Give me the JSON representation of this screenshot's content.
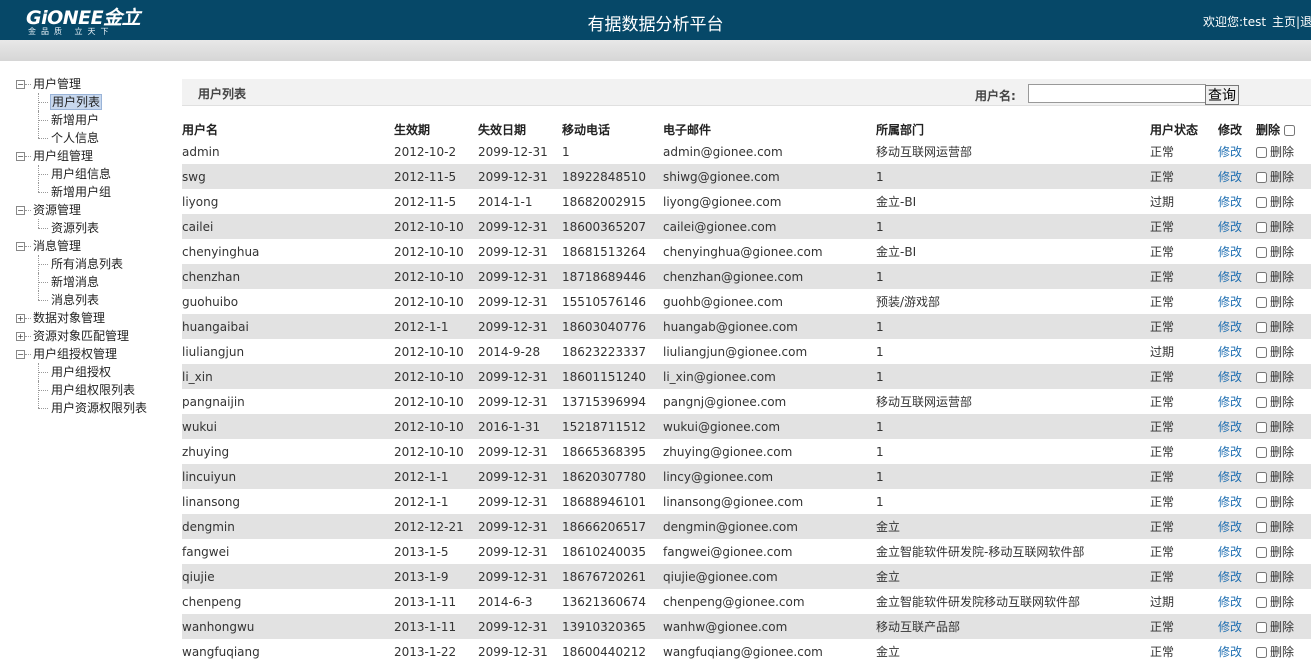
{
  "header": {
    "logo_main": "GiONEE金立",
    "logo_sub": "金品质 立天下",
    "title": "有据数据分析平台",
    "welcome": "欢迎您:test",
    "links": [
      "主页",
      "退"
    ]
  },
  "sidebar": {
    "groups": [
      {
        "label": "用户管理",
        "expanded": true,
        "children": [
          "用户列表",
          "新增用户",
          "个人信息"
        ]
      },
      {
        "label": "用户组管理",
        "expanded": true,
        "children": [
          "用户组信息",
          "新增用户组"
        ]
      },
      {
        "label": "资源管理",
        "expanded": true,
        "children": [
          "资源列表"
        ]
      },
      {
        "label": "消息管理",
        "expanded": true,
        "children": [
          "所有消息列表",
          "新增消息",
          "消息列表"
        ]
      },
      {
        "label": "数据对象管理",
        "expanded": false,
        "children": []
      },
      {
        "label": "资源对象匹配管理",
        "expanded": false,
        "children": []
      },
      {
        "label": "用户组授权管理",
        "expanded": true,
        "children": [
          "用户组授权",
          "用户组权限列表",
          "用户资源权限列表"
        ]
      }
    ],
    "selected": "用户列表"
  },
  "toolbar": {
    "list_title": "用户列表",
    "search_label": "用户名:",
    "search_value": "",
    "search_button": "查询"
  },
  "table": {
    "columns": [
      "用户名",
      "生效期",
      "失效日期",
      "移动电话",
      "电子邮件",
      "所属部门",
      "用户状态",
      "修改",
      "删除"
    ],
    "edit_label": "修改",
    "delete_label": "删除",
    "rows": [
      [
        "admin",
        "2012-10-2",
        "2099-12-31",
        "1",
        "admin@gionee.com",
        "移动互联网运营部",
        "正常"
      ],
      [
        "swg",
        "2012-11-5",
        "2099-12-31",
        "18922848510",
        "shiwg@gionee.com",
        "1",
        "正常"
      ],
      [
        "liyong",
        "2012-11-5",
        "2014-1-1",
        "18682002915",
        "liyong@gionee.com",
        "金立-BI",
        "过期"
      ],
      [
        "cailei",
        "2012-10-10",
        "2099-12-31",
        "18600365207",
        "cailei@gionee.com",
        "1",
        "正常"
      ],
      [
        "chenyinghua",
        "2012-10-10",
        "2099-12-31",
        "18681513264",
        "chenyinghua@gionee.com",
        "金立-BI",
        "正常"
      ],
      [
        "chenzhan",
        "2012-10-10",
        "2099-12-31",
        "18718689446",
        "chenzhan@gionee.com",
        "1",
        "正常"
      ],
      [
        "guohuibo",
        "2012-10-10",
        "2099-12-31",
        "15510576146",
        "guohb@gionee.com",
        "预装/游戏部",
        "正常"
      ],
      [
        "huangaibai",
        "2012-1-1",
        "2099-12-31",
        "18603040776",
        "huangab@gionee.com",
        "1",
        "正常"
      ],
      [
        "liuliangjun",
        "2012-10-10",
        "2014-9-28",
        "18623223337",
        "liuliangjun@gionee.com",
        "1",
        "过期"
      ],
      [
        "li_xin",
        "2012-10-10",
        "2099-12-31",
        "18601151240",
        "li_xin@gionee.com",
        "1",
        "正常"
      ],
      [
        "pangnaijin",
        "2012-10-10",
        "2099-12-31",
        "13715396994",
        "pangnj@gionee.com",
        "移动互联网运营部",
        "正常"
      ],
      [
        "wukui",
        "2012-10-10",
        "2016-1-31",
        "15218711512",
        "wukui@gionee.com",
        "1",
        "正常"
      ],
      [
        "zhuying",
        "2012-10-10",
        "2099-12-31",
        "18665368395",
        "zhuying@gionee.com",
        "1",
        "正常"
      ],
      [
        "lincuiyun",
        "2012-1-1",
        "2099-12-31",
        "18620307780",
        "lincy@gionee.com",
        "1",
        "正常"
      ],
      [
        "linansong",
        "2012-1-1",
        "2099-12-31",
        "18688946101",
        "linansong@gionee.com",
        "1",
        "正常"
      ],
      [
        "dengmin",
        "2012-12-21",
        "2099-12-31",
        "18666206517",
        "dengmin@gionee.com",
        "金立",
        "正常"
      ],
      [
        "fangwei",
        "2013-1-5",
        "2099-12-31",
        "18610240035",
        "fangwei@gionee.com",
        "金立智能软件研发院-移动互联网软件部",
        "正常"
      ],
      [
        "qiujie",
        "2013-1-9",
        "2099-12-31",
        "18676720261",
        "qiujie@gionee.com",
        "金立",
        "正常"
      ],
      [
        "chenpeng",
        "2013-1-11",
        "2014-6-3",
        "13621360674",
        "chenpeng@gionee.com",
        "金立智能软件研发院移动互联网软件部",
        "过期"
      ],
      [
        "wanhongwu",
        "2013-1-11",
        "2099-12-31",
        "13910320365",
        "wanhw@gionee.com",
        "移动互联产品部",
        "正常"
      ],
      [
        "wangfuqiang",
        "2013-1-22",
        "2099-12-31",
        "18600440212",
        "wangfuqiang@gionee.com",
        "金立",
        "正常"
      ]
    ]
  }
}
